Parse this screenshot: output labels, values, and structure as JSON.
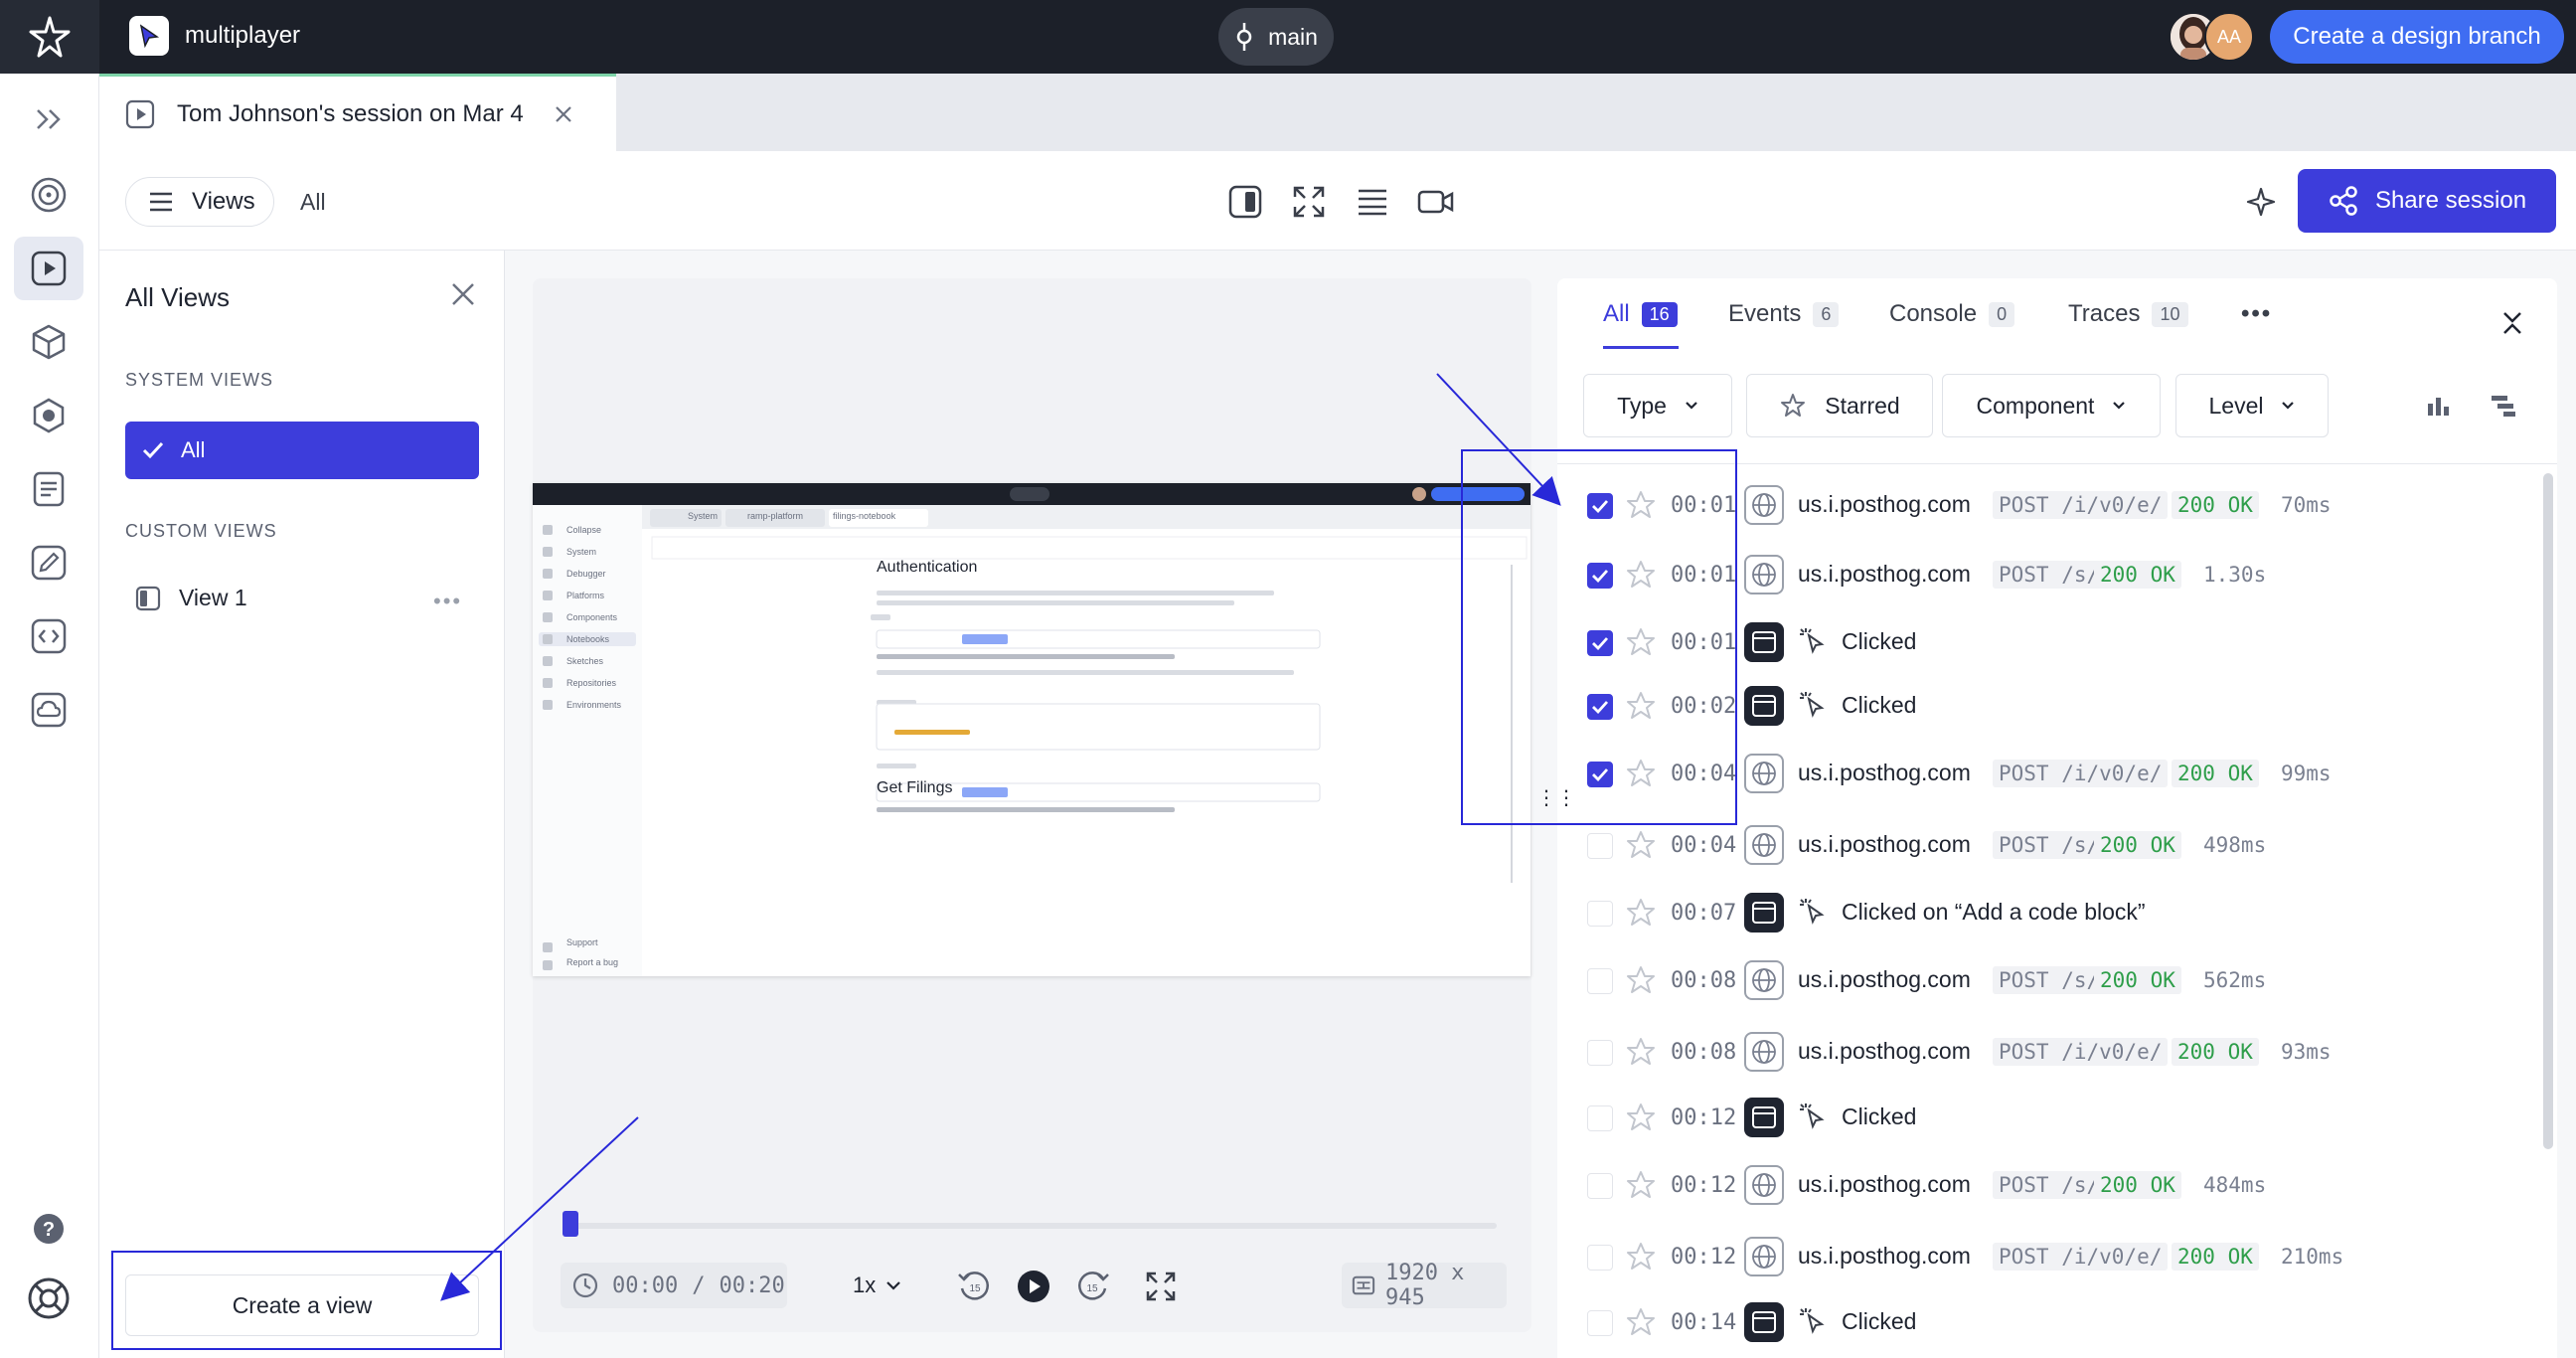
{
  "topbar": {
    "project_name": "multiplayer",
    "branch": "main",
    "avatar_initials": "AA",
    "design_branch_button": "Create a design branch"
  },
  "tabs": {
    "session_tab": "Tom Johnson's session on Mar 4"
  },
  "toolbar": {
    "views_button": "Views",
    "views_filter_label": "All",
    "share_button": "Share session"
  },
  "views_panel": {
    "title": "All Views",
    "system_views_label": "SYSTEM VIEWS",
    "system_views": [
      "All"
    ],
    "custom_views_label": "CUSTOM VIEWS",
    "custom_views": [
      "View 1"
    ],
    "create_view_button": "Create a view"
  },
  "player": {
    "current_time": "00:00",
    "separator": "/",
    "duration": "00:20",
    "speed": "1x",
    "rewind_seconds": "15",
    "forward_seconds": "15",
    "resolution": "1920 x 945",
    "progress": 0.0
  },
  "events": {
    "tabs": [
      {
        "label": "All",
        "count": "16"
      },
      {
        "label": "Events",
        "count": "6"
      },
      {
        "label": "Console",
        "count": "0"
      },
      {
        "label": "Traces",
        "count": "10"
      }
    ],
    "filters": {
      "type": "Type",
      "starred": "Starred",
      "component": "Component",
      "level": "Level"
    },
    "rows": [
      {
        "checked": true,
        "time": "00:01",
        "kind": "network",
        "host": "us.i.posthog.com",
        "method": "POST /i/v0/e/",
        "status": "200 OK",
        "duration": "70ms"
      },
      {
        "checked": true,
        "time": "00:01",
        "kind": "network",
        "host": "us.i.posthog.com",
        "method": "POST /s/",
        "status": "200 OK",
        "duration": "1.30s"
      },
      {
        "checked": true,
        "time": "00:01",
        "kind": "click",
        "text": "Clicked"
      },
      {
        "checked": true,
        "time": "00:02",
        "kind": "click",
        "text": "Clicked"
      },
      {
        "checked": true,
        "time": "00:04",
        "kind": "network",
        "host": "us.i.posthog.com",
        "method": "POST /i/v0/e/",
        "status": "200 OK",
        "duration": "99ms"
      },
      {
        "checked": false,
        "time": "00:04",
        "kind": "network",
        "host": "us.i.posthog.com",
        "method": "POST /s/",
        "status": "200 OK",
        "duration": "498ms"
      },
      {
        "checked": false,
        "time": "00:07",
        "kind": "click",
        "text": "Clicked on “Add a code block”"
      },
      {
        "checked": false,
        "time": "00:08",
        "kind": "network",
        "host": "us.i.posthog.com",
        "method": "POST /s/",
        "status": "200 OK",
        "duration": "562ms"
      },
      {
        "checked": false,
        "time": "00:08",
        "kind": "network",
        "host": "us.i.posthog.com",
        "method": "POST /i/v0/e/",
        "status": "200 OK",
        "duration": "93ms"
      },
      {
        "checked": false,
        "time": "00:12",
        "kind": "click",
        "text": "Clicked"
      },
      {
        "checked": false,
        "time": "00:12",
        "kind": "network",
        "host": "us.i.posthog.com",
        "method": "POST /s/",
        "status": "200 OK",
        "duration": "484ms"
      },
      {
        "checked": false,
        "time": "00:12",
        "kind": "network",
        "host": "us.i.posthog.com",
        "method": "POST /i/v0/e/",
        "status": "200 OK",
        "duration": "210ms"
      },
      {
        "checked": false,
        "time": "00:14",
        "kind": "click",
        "text": "Clicked"
      }
    ]
  },
  "thumbnail": {
    "heading1": "Authentication",
    "heading2": "Get Filings",
    "nav": [
      "Collapse",
      "System",
      "Debugger",
      "Platforms",
      "Components",
      "Notebooks",
      "Sketches",
      "Repositories",
      "Environments",
      "Support",
      "Report a bug"
    ],
    "tabs": [
      "System",
      "ramp-platform",
      "filings-notebook"
    ]
  },
  "colors": {
    "accent": "#3d3ddb",
    "topbar": "#1c2029",
    "design_button": "#3f6df2",
    "status_ok": "#2e9e4a"
  }
}
